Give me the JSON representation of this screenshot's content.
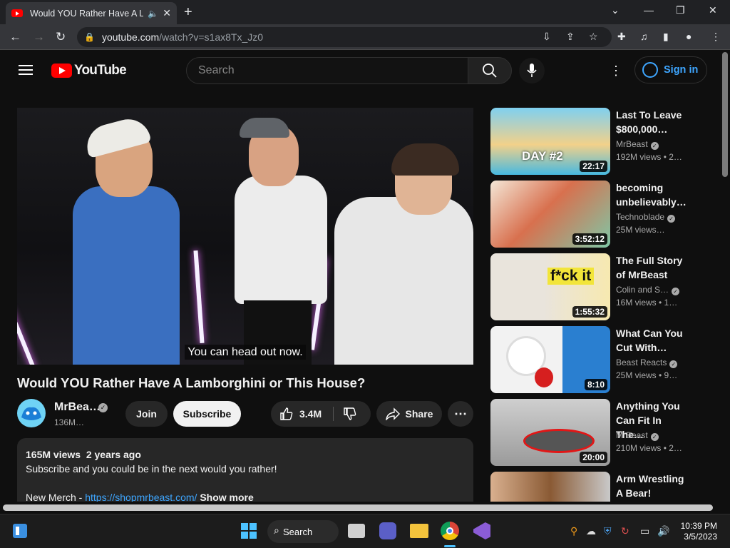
{
  "browser": {
    "tab_title": "Would YOU Rather Have A La",
    "url_host": "youtube.com",
    "url_path": "/watch?v=s1ax8Tx_Jz0"
  },
  "header": {
    "logo_text": "YouTube",
    "search_placeholder": "Search",
    "signin_label": "Sign in"
  },
  "video": {
    "caption": "You can head out now.",
    "title": "Would YOU Rather Have A Lamborghini or This House?",
    "channel": "MrBea…",
    "subscribers": "136M…",
    "join_label": "Join",
    "subscribe_label": "Subscribe",
    "likes": "3.4M",
    "share_label": "Share",
    "views": "165M views",
    "age": "2 years ago",
    "description_line1": "Subscribe and you could be in the next would you rather!",
    "merch_prefix": "New Merch - ",
    "merch_link": "https://shopmrbeast.com/",
    "show_more": "Show more"
  },
  "recommendations": [
    {
      "title": "Last To Leave $800,000…",
      "channel": "MrBeast",
      "verified": true,
      "meta": "192M views • 2…",
      "duration": "22:17",
      "thumb_text": "DAY #2"
    },
    {
      "title": "becoming unbelievably…",
      "channel": "Technoblade",
      "verified": true,
      "meta": "25M views…",
      "duration": "3:52:12"
    },
    {
      "title": "The Full Story of MrBeast",
      "channel": "Colin and S…",
      "verified": true,
      "meta": "16M views • 1…",
      "duration": "1:55:32",
      "thumb_text": "f*ck it"
    },
    {
      "title": "What Can You Cut With…",
      "channel": "Beast Reacts",
      "verified": true,
      "meta": "25M views • 9…",
      "duration": "8:10"
    },
    {
      "title": "Anything You Can Fit In The…",
      "channel": "MrBeast",
      "verified": true,
      "meta": "210M views • 2…",
      "duration": "20:00"
    },
    {
      "title": "Arm Wrestling A Bear!",
      "channel": "",
      "verified": false,
      "meta": "",
      "duration": ""
    }
  ],
  "taskbar": {
    "search_label": "Search",
    "time": "10:39 PM",
    "date": "3/5/2023"
  },
  "colors": {
    "background": "#0f0f0f",
    "brand_red": "#ff0000",
    "link_blue": "#3ea6ff"
  }
}
